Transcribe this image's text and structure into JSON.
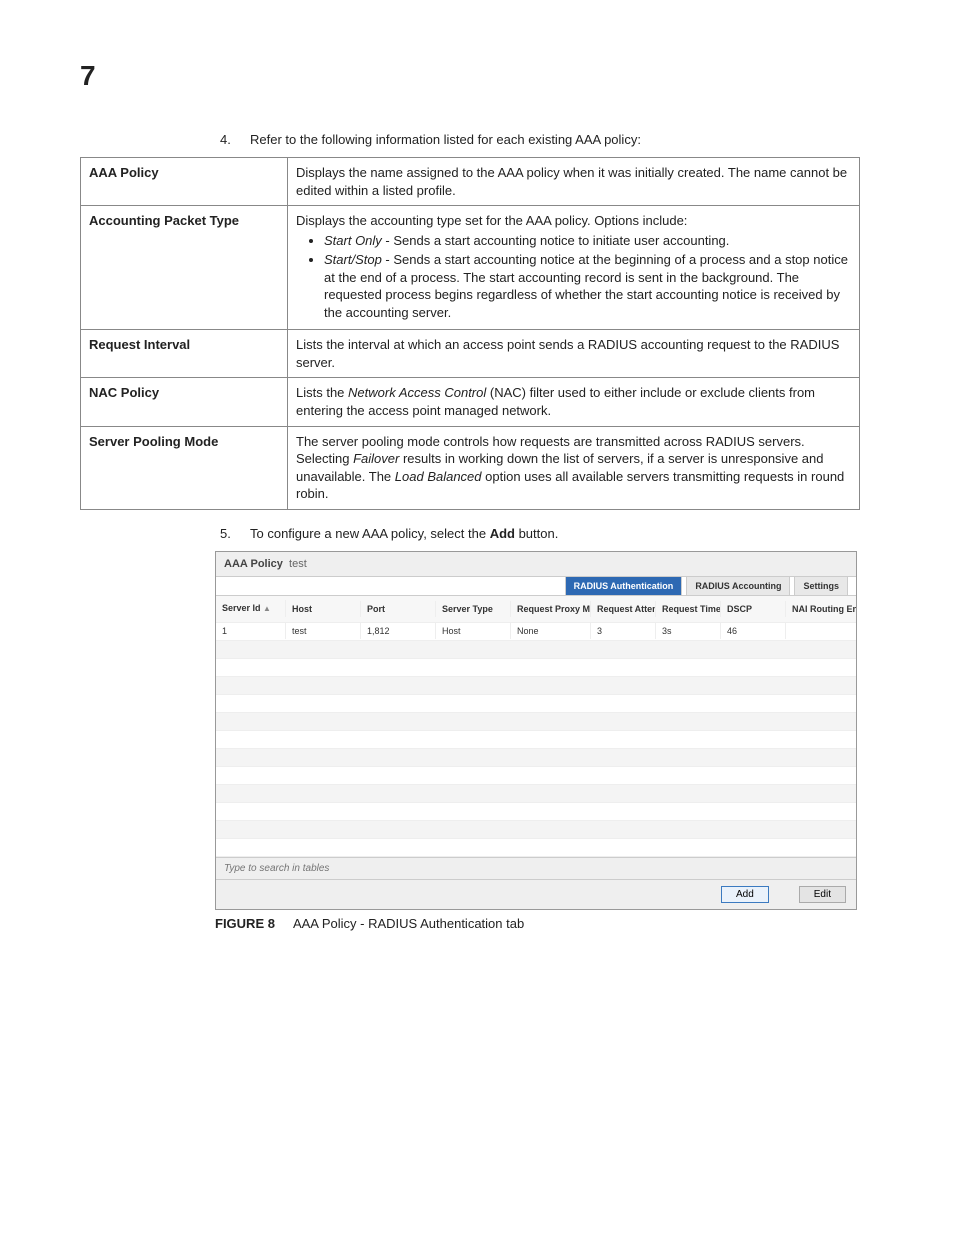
{
  "chapter": "7",
  "steps": {
    "s4": {
      "num": "4.",
      "text": "Refer to the following information listed for each existing AAA policy:"
    },
    "s5": {
      "num": "5.",
      "prefix": "To configure a new AAA policy, select the ",
      "bold": "Add",
      "suffix": " button."
    }
  },
  "table": {
    "row1": {
      "label": "AAA Policy",
      "desc": "Displays the name assigned to the AAA policy when it was initially created. The name cannot be edited within a listed profile."
    },
    "row2": {
      "label": "Accounting Packet Type",
      "intro": "Displays the accounting type set for the AAA policy. Options include:",
      "b1_i": "Start Only",
      "b1_rest": " - Sends a start accounting notice to initiate user accounting.",
      "b2_i": "Start/Stop",
      "b2_rest": " - Sends a start accounting notice at the beginning of a process and a stop notice at the end of a process. The start accounting record is sent in the background. The requested process begins regardless of whether the start accounting notice is received by the accounting server."
    },
    "row3": {
      "label": "Request Interval",
      "desc": "Lists the interval at which an access point sends a RADIUS accounting request to the RADIUS server."
    },
    "row4": {
      "label": "NAC Policy",
      "pre": "Lists the ",
      "i": "Network Access Control",
      "post": " (NAC) filter used to either include or exclude clients from entering the access point managed network."
    },
    "row5": {
      "label": "Server Pooling Mode",
      "pre": "The server pooling mode controls how requests are transmitted across RADIUS servers. Selecting ",
      "i1": "Failover",
      "mid": " results in working down the list of servers, if a server is unresponsive and unavailable. The ",
      "i2": "Load Balanced",
      "post": " option uses all available servers transmitting requests in round robin."
    }
  },
  "screenshot": {
    "title_label": "AAA Policy",
    "title_value": "test",
    "tabs": {
      "t1": "RADIUS Authentication",
      "t2": "RADIUS Accounting",
      "t3": "Settings"
    },
    "headers": {
      "h1": "Server Id",
      "h2": "Host",
      "h3": "Port",
      "h4": "Server Type",
      "h5": "Request Proxy Mode",
      "h6": "Request Attempts",
      "h7": "Request Timeout",
      "h8": "DSCP",
      "h9": "NAI Routing Enable"
    },
    "row": {
      "c1": "1",
      "c2": "test",
      "c3": "1,812",
      "c4": "Host",
      "c5": "None",
      "c6": "3",
      "c7": "3s",
      "c8": "46",
      "c9": ""
    },
    "search_placeholder": "Type to search in tables",
    "btn_add": "Add",
    "btn_edit": "Edit"
  },
  "figure": {
    "label": "FIGURE 8",
    "caption": "AAA Policy - RADIUS Authentication tab"
  }
}
